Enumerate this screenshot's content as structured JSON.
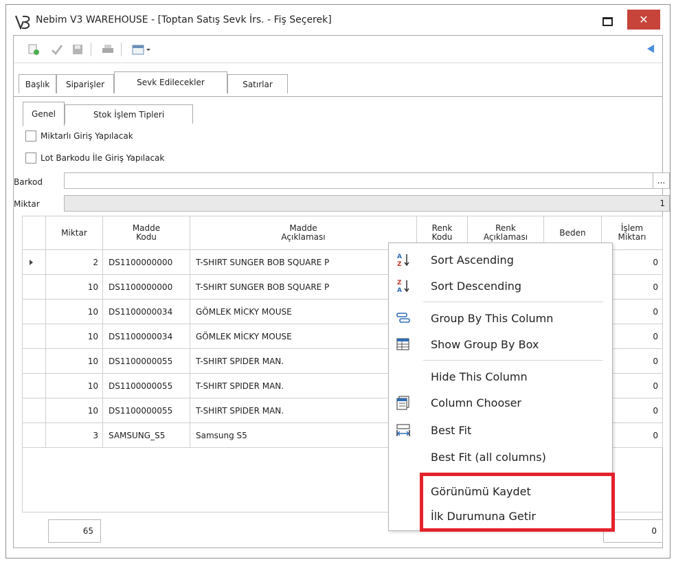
{
  "window": {
    "title": "Nebim V3 WAREHOUSE - [Toptan Satış Sevk İrs. - Fiş Seçerek]",
    "close_label": "✕"
  },
  "tabs": [
    {
      "label": "Başlık"
    },
    {
      "label": "Siparişler"
    },
    {
      "label": "Sevk Edilecekler",
      "active": true
    },
    {
      "label": "Satırlar"
    }
  ],
  "subtabs": [
    {
      "label": "Genel",
      "active": true
    },
    {
      "label": "Stok İşlem Tipleri"
    }
  ],
  "form": {
    "checkbox1": "Miktarlı Giriş Yapılacak",
    "checkbox2": "Lot Barkodu İle Giriş Yapılacak",
    "barkod_label": "Barkod",
    "barkod_value": "",
    "barkod_button": "...",
    "miktar_label": "Miktar",
    "miktar_value": "1"
  },
  "grid": {
    "headers": {
      "miktar": "Miktar",
      "madde_kodu_1": "Madde",
      "madde_kodu_2": "Kodu",
      "madde_aciklama_1": "Madde",
      "madde_aciklama_2": "Açıklaması",
      "renk_kodu_1": "Renk",
      "renk_kodu_2": "Kodu",
      "renk_aciklama_1": "Renk",
      "renk_aciklama_2": "Açıklaması",
      "beden": "Beden",
      "islem_1": "İşlem",
      "islem_2": "Miktarı"
    },
    "rows": [
      {
        "miktar": "2",
        "kod": "DS1100000000",
        "aciklama": "T-SHIRT SUNGER BOB SQUARE P",
        "islem": "0"
      },
      {
        "miktar": "10",
        "kod": "DS1100000000",
        "aciklama": "T-SHIRT SUNGER BOB SQUARE P",
        "islem": "0"
      },
      {
        "miktar": "10",
        "kod": "DS1100000034",
        "aciklama": "GÖMLEK MİCKY MOUSE",
        "islem": "0"
      },
      {
        "miktar": "10",
        "kod": "DS1100000034",
        "aciklama": "GÖMLEK MİCKY MOUSE",
        "islem": "0"
      },
      {
        "miktar": "10",
        "kod": "DS1100000055",
        "aciklama": "T-SHIRT SPIDER MAN.",
        "islem": "0"
      },
      {
        "miktar": "10",
        "kod": "DS1100000055",
        "aciklama": "T-SHIRT SPIDER MAN.",
        "islem": "0"
      },
      {
        "miktar": "10",
        "kod": "DS1100000055",
        "aciklama": "T-SHIRT SPIDER MAN.",
        "islem": "0"
      },
      {
        "miktar": "3",
        "kod": "SAMSUNG_S5",
        "aciklama": "Samsung S5",
        "islem": "0"
      }
    ],
    "footer_total": "65",
    "footer_islem": "0"
  },
  "context_menu": {
    "items": [
      {
        "label": "Sort Ascending",
        "icon": "sort-ascending-icon"
      },
      {
        "label": "Sort Descending",
        "icon": "sort-descending-icon"
      },
      {
        "label": "Group By This Column",
        "icon": "group-by-icon"
      },
      {
        "label": "Show Group By Box",
        "icon": "group-box-icon"
      },
      {
        "label": "Hide This Column",
        "icon": ""
      },
      {
        "label": "Column Chooser",
        "icon": "column-chooser-icon"
      },
      {
        "label": "Best Fit",
        "icon": "best-fit-icon"
      },
      {
        "label": "Best Fit (all columns)",
        "icon": ""
      },
      {
        "label": "Görünümü Kaydet",
        "icon": ""
      },
      {
        "label": "İlk Durumuna Getir",
        "icon": ""
      }
    ]
  },
  "colors": {
    "close_button": "#c7443b",
    "highlight": "#e4222b",
    "accent_blue": "#4a8ddb"
  }
}
